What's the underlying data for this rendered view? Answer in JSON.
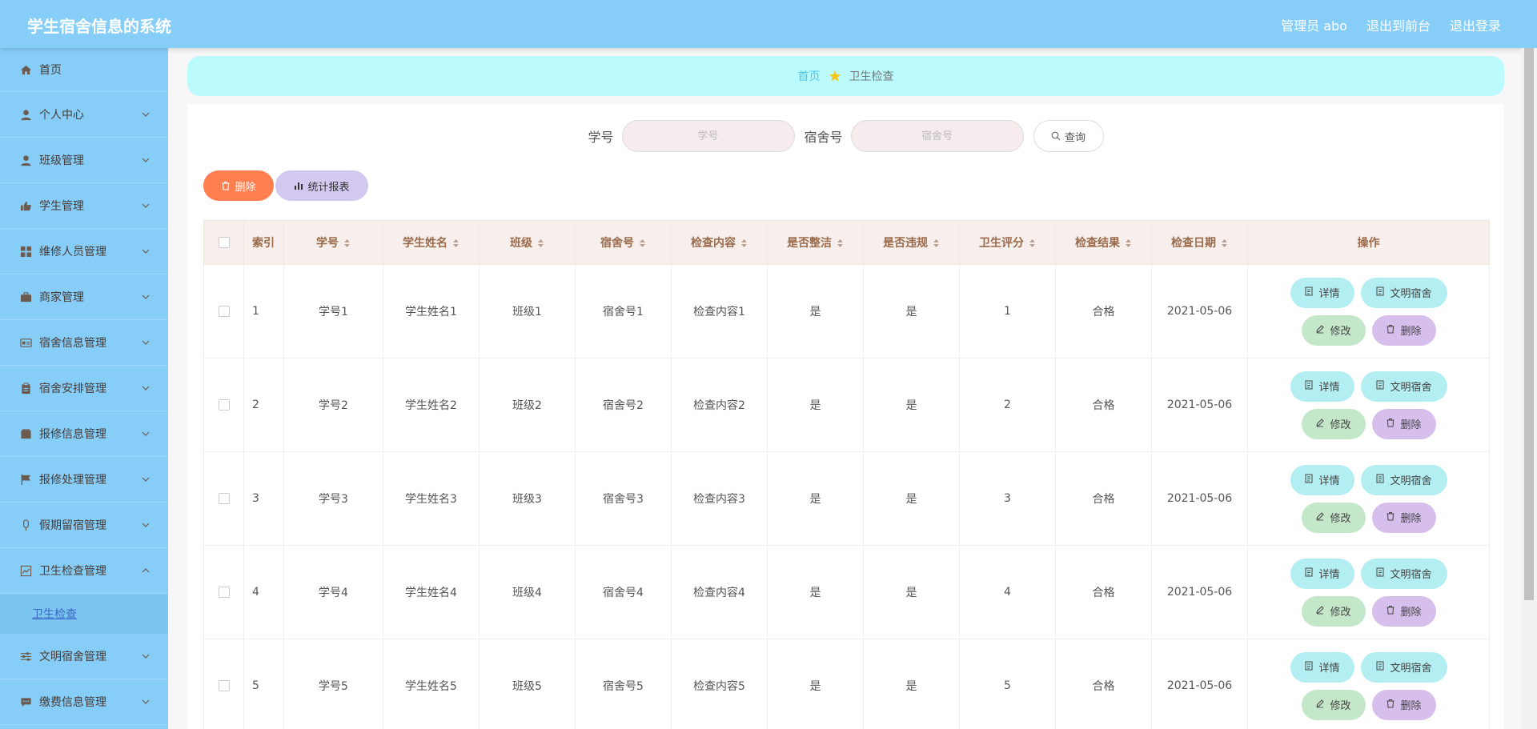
{
  "header": {
    "title": "学生宿舍信息的系统",
    "user": "管理员 abo",
    "frontend": "退出到前台",
    "logout": "退出登录"
  },
  "sidebar": {
    "items": [
      {
        "label": "首页",
        "icon": "home-icon"
      },
      {
        "label": "个人中心",
        "icon": "user-icon"
      },
      {
        "label": "班级管理",
        "icon": "user-icon"
      },
      {
        "label": "学生管理",
        "icon": "like-icon"
      },
      {
        "label": "维修人员管理",
        "icon": "grid-icon"
      },
      {
        "label": "商家管理",
        "icon": "briefcase-icon"
      },
      {
        "label": "宿舍信息管理",
        "icon": "id-card-icon"
      },
      {
        "label": "宿舍安排管理",
        "icon": "clipboard-icon"
      },
      {
        "label": "报修信息管理",
        "icon": "album-icon"
      },
      {
        "label": "报修处理管理",
        "icon": "flag-icon"
      },
      {
        "label": "假期留宿管理",
        "icon": "mic-icon"
      },
      {
        "label": "卫生检查管理",
        "icon": "chart-icon"
      },
      {
        "label": "文明宿舍管理",
        "icon": "sliders-icon"
      },
      {
        "label": "缴费信息管理",
        "icon": "chat-icon"
      }
    ],
    "submenu": "卫生检查"
  },
  "breadcrumb": {
    "home": "首页",
    "current": "卫生检查"
  },
  "search": {
    "student_no_label": "学号",
    "student_no_placeholder": "学号",
    "dorm_no_label": "宿舍号",
    "dorm_no_placeholder": "宿舍号",
    "query_label": "查询"
  },
  "actions": {
    "delete_label": "删除",
    "report_label": "统计报表"
  },
  "table": {
    "columns": [
      "索引",
      "学号",
      "学生姓名",
      "班级",
      "宿舍号",
      "检查内容",
      "是否整洁",
      "是否违规",
      "卫生评分",
      "检查结果",
      "检查日期",
      "操作"
    ],
    "rows": [
      [
        "1",
        "学号1",
        "学生姓名1",
        "班级1",
        "宿舍号1",
        "检查内容1",
        "是",
        "是",
        "1",
        "合格",
        "2021-05-06"
      ],
      [
        "2",
        "学号2",
        "学生姓名2",
        "班级2",
        "宿舍号2",
        "检查内容2",
        "是",
        "是",
        "2",
        "合格",
        "2021-05-06"
      ],
      [
        "3",
        "学号3",
        "学生姓名3",
        "班级3",
        "宿舍号3",
        "检查内容3",
        "是",
        "是",
        "3",
        "合格",
        "2021-05-06"
      ],
      [
        "4",
        "学号4",
        "学生姓名4",
        "班级4",
        "宿舍号4",
        "检查内容4",
        "是",
        "是",
        "4",
        "合格",
        "2021-05-06"
      ],
      [
        "5",
        "学号5",
        "学生姓名5",
        "班级5",
        "宿舍号5",
        "检查内容5",
        "是",
        "是",
        "5",
        "合格",
        "2021-05-06"
      ]
    ],
    "ops": {
      "detail": "详情",
      "civil": "文明宿舍",
      "edit": "修改",
      "delete": "删除"
    }
  },
  "colors": {
    "header": "#86cef8",
    "breadcrumb_bg": "#bbfbfe",
    "delete_btn": "#ff7f50",
    "report_btn": "#d3c9f0",
    "detail_btn": "#b3eef2",
    "edit_btn": "#c4e7c9",
    "del_btn": "#d6bfec"
  }
}
